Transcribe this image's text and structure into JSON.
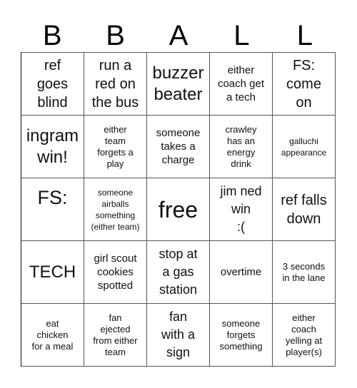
{
  "title_letters": [
    "B",
    "B",
    "A",
    "L",
    "L"
  ],
  "cells": [
    {
      "text": "ref\ngoes\nblind",
      "size": "s20"
    },
    {
      "text": "run a\nred on\nthe bus",
      "size": "s20"
    },
    {
      "text": "buzzer\nbeater",
      "size": "s24"
    },
    {
      "text": "either\ncoach get\na tech",
      "size": "s15"
    },
    {
      "text": "FS:\ncome\non",
      "size": "s20"
    },
    {
      "text": "ingram\nwin!",
      "size": "s24"
    },
    {
      "text": "either\nteam\nforgets a\nplay",
      "size": "s13"
    },
    {
      "text": "someone\ntakes a\ncharge",
      "size": "s15"
    },
    {
      "text": "crawley\nhas an\nenergy\ndrink",
      "size": "s13"
    },
    {
      "text": "galluchi\nappearance",
      "size": "s12"
    },
    {
      "text": "FS:",
      "size": "s27",
      "align": "top"
    },
    {
      "text": "someone\nairballs\nsomething\n(either team)",
      "size": "s12"
    },
    {
      "text": "free",
      "size": "s32"
    },
    {
      "text": "jim ned\nwin\n:(",
      "size": "s18"
    },
    {
      "text": "ref falls\ndown",
      "size": "s20"
    },
    {
      "text": "TECH",
      "size": "s24"
    },
    {
      "text": "girl scout\ncookies\nspotted",
      "size": "s15"
    },
    {
      "text": "stop at\na gas\nstation",
      "size": "s18"
    },
    {
      "text": "overtime",
      "size": "s15"
    },
    {
      "text": "3 seconds\nin the lane",
      "size": "s13"
    },
    {
      "text": "eat\nchicken\nfor a meal",
      "size": "s13"
    },
    {
      "text": "fan\nejected\nfrom either\nteam",
      "size": "s13"
    },
    {
      "text": "fan\nwith a\nsign",
      "size": "s18"
    },
    {
      "text": "someone\nforgets\nsomething",
      "size": "s13"
    },
    {
      "text": "either\ncoach\nyelling at\nplayer(s)",
      "size": "s13"
    }
  ]
}
